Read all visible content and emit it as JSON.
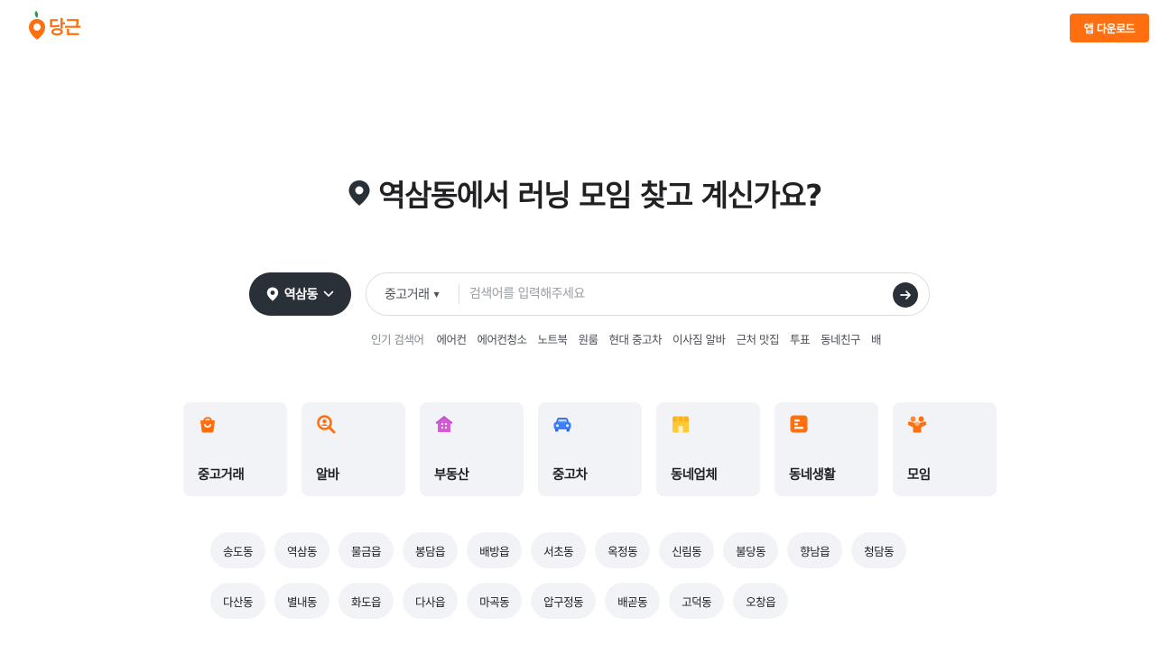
{
  "header": {
    "logo_text": "당근",
    "app_download": "앱 다운로드"
  },
  "hero": {
    "title": "역삼동에서 러닝 모임 찾고 계신가요?"
  },
  "location": {
    "label": "역삼동"
  },
  "search": {
    "category": "중고거래",
    "placeholder": "검색어를 입력해주세요"
  },
  "popular": {
    "label": "인기 검색어",
    "keywords": [
      "에어컨",
      "에어컨청소",
      "노트북",
      "원룸",
      "현대 중고차",
      "이사짐 알바",
      "근처 맛집",
      "투표",
      "동네친구",
      "배"
    ]
  },
  "categories": [
    {
      "label": "중고거래",
      "icon": "shopping-bag-icon"
    },
    {
      "label": "알바",
      "icon": "magnifier-icon"
    },
    {
      "label": "부동산",
      "icon": "house-icon"
    },
    {
      "label": "중고차",
      "icon": "car-icon"
    },
    {
      "label": "동네업체",
      "icon": "store-icon"
    },
    {
      "label": "동네생활",
      "icon": "document-icon"
    },
    {
      "label": "모임",
      "icon": "people-icon"
    }
  ],
  "neighborhoods": {
    "row1": [
      "송도동",
      "역삼동",
      "물금읍",
      "봉담읍",
      "배방읍",
      "서초동",
      "옥정동",
      "신림동",
      "불당동",
      "향남읍",
      "청담동"
    ],
    "row2": [
      "다산동",
      "별내동",
      "화도읍",
      "다사읍",
      "마곡동",
      "압구정동",
      "배곧동",
      "고덕동",
      "오창읍"
    ]
  },
  "colors": {
    "brand": "#ff6f0f",
    "dark": "#2a3038",
    "tile": "#f2f3f6"
  }
}
